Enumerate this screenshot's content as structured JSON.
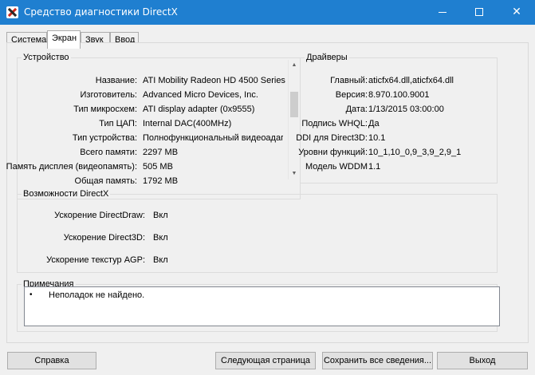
{
  "window": {
    "title": "Средство диагностики DirectX",
    "minimize_glyph": "",
    "close_glyph": "✕"
  },
  "tabs": [
    {
      "label": "Система"
    },
    {
      "label": "Экран"
    },
    {
      "label": "Звук"
    },
    {
      "label": "Ввод"
    }
  ],
  "device": {
    "title": "Устройство",
    "rows": [
      {
        "label": "Название:",
        "value": "ATI Mobility Radeon HD 4500 Series"
      },
      {
        "label": "Изготовитель:",
        "value": "Advanced Micro Devices, Inc."
      },
      {
        "label": "Тип микросхем:",
        "value": "ATI display adapter (0x9555)"
      },
      {
        "label": "Тип ЦАП:",
        "value": "Internal DAC(400MHz)"
      },
      {
        "label": "Тип устройства:",
        "value": "Полнофункциональный видеоадап"
      },
      {
        "label": "Всего памяти:",
        "value": "2297 MB"
      },
      {
        "label": "Память дисплея (видеопамять):",
        "value": "505 MB"
      },
      {
        "label": "Общая память:",
        "value": "1792 MB"
      }
    ]
  },
  "drivers": {
    "title": "Драйверы",
    "rows": [
      {
        "label": "Главный:",
        "value": "aticfx64.dll,aticfx64.dll"
      },
      {
        "label": "Версия:",
        "value": "8.970.100.9001"
      },
      {
        "label": "Дата:",
        "value": "1/13/2015 03:00:00"
      },
      {
        "label": "Подпись WHQL:",
        "value": "Да"
      },
      {
        "label": "DDI для Direct3D:",
        "value": "10.1"
      },
      {
        "label": "Уровни функций:",
        "value": "10_1,10_0,9_3,9_2,9_1"
      },
      {
        "label": "Модель WDDM",
        "value": "1.1"
      }
    ]
  },
  "directx_features": {
    "title": "Возможности DirectX",
    "rows": [
      {
        "label": "Ускорение DirectDraw:",
        "value": "Вкл"
      },
      {
        "label": "Ускорение Direct3D:",
        "value": "Вкл"
      },
      {
        "label": "Ускорение текстур AGP:",
        "value": "Вкл"
      }
    ]
  },
  "notes": {
    "title": "Примечания",
    "bullet": "•",
    "text": "Неполадок не найдено."
  },
  "buttons": {
    "help": "Справка",
    "next_page": "Следующая страница",
    "save_all": "Сохранить все сведения...",
    "exit": "Выход"
  },
  "colors": {
    "titlebar": "#1f7fd0",
    "window_bg": "#f0f0f0"
  }
}
